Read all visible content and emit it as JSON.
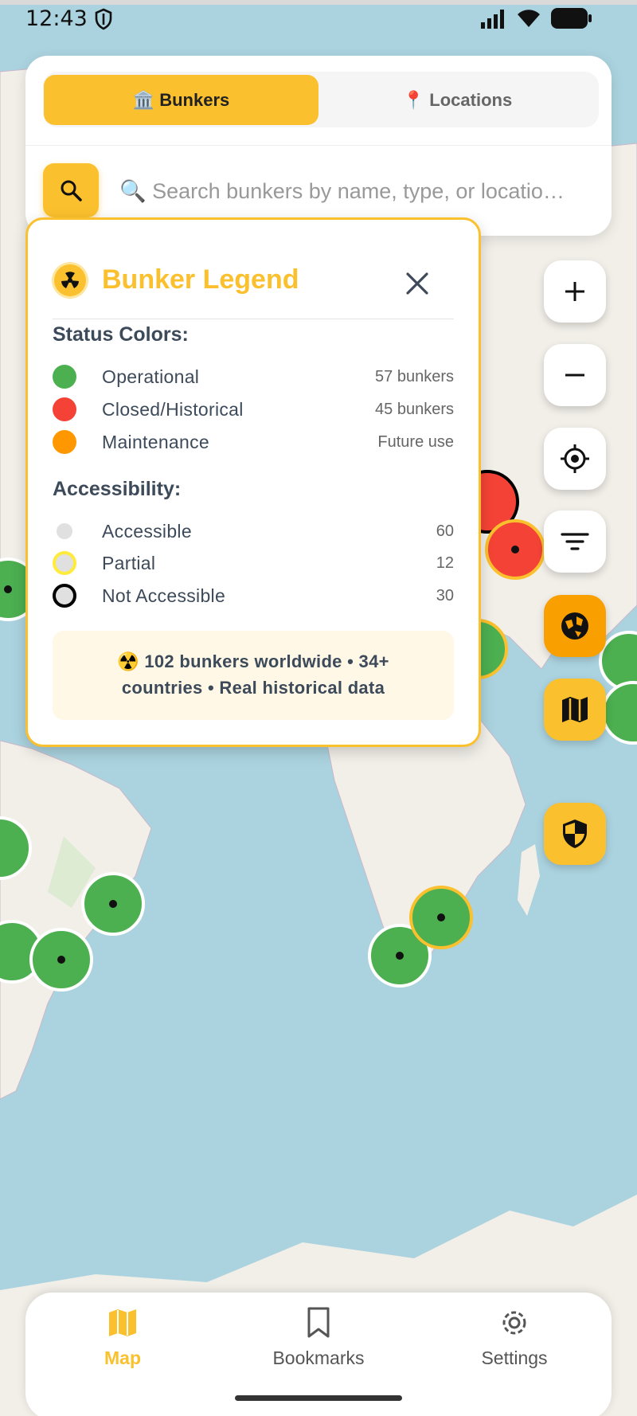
{
  "status_bar": {
    "time": "12:43"
  },
  "tabs": [
    {
      "label": "🏛️ Bunkers",
      "active": true
    },
    {
      "label": "📍 Locations",
      "active": false
    }
  ],
  "search": {
    "placeholder": "🔍 Search bunkers by name, type, or locatio…"
  },
  "legend": {
    "title": "Bunker Legend",
    "status_heading": "Status Colors:",
    "status_items": [
      {
        "label": "Operational",
        "value": "57 bunkers",
        "color": "#4caf50"
      },
      {
        "label": "Closed/Historical",
        "value": "45 bunkers",
        "color": "#f44336"
      },
      {
        "label": "Maintenance",
        "value": "Future use",
        "color": "#ff9800"
      }
    ],
    "access_heading": "Accessibility:",
    "access_items": [
      {
        "label": "Accessible",
        "value": "60",
        "border": "#ffffff"
      },
      {
        "label": "Partial",
        "value": "12",
        "border": "#ffeb3b"
      },
      {
        "label": "Not Accessible",
        "value": "30",
        "border": "#000000"
      }
    ],
    "info_line1": "☢️ 102 bunkers worldwide • 34+",
    "info_line2": "countries • Real historical data"
  },
  "map_controls": [
    "zoom-in",
    "zoom-out",
    "my-location",
    "filter",
    "globe",
    "map",
    "security-shield"
  ],
  "bottom_nav": [
    {
      "label": "Map",
      "active": true
    },
    {
      "label": "Bookmarks",
      "active": false
    },
    {
      "label": "Settings",
      "active": false
    }
  ],
  "colors": {
    "accent": "#fbc02d",
    "accent_orange": "#f9a000",
    "operational": "#4caf50",
    "closed": "#f44336"
  }
}
